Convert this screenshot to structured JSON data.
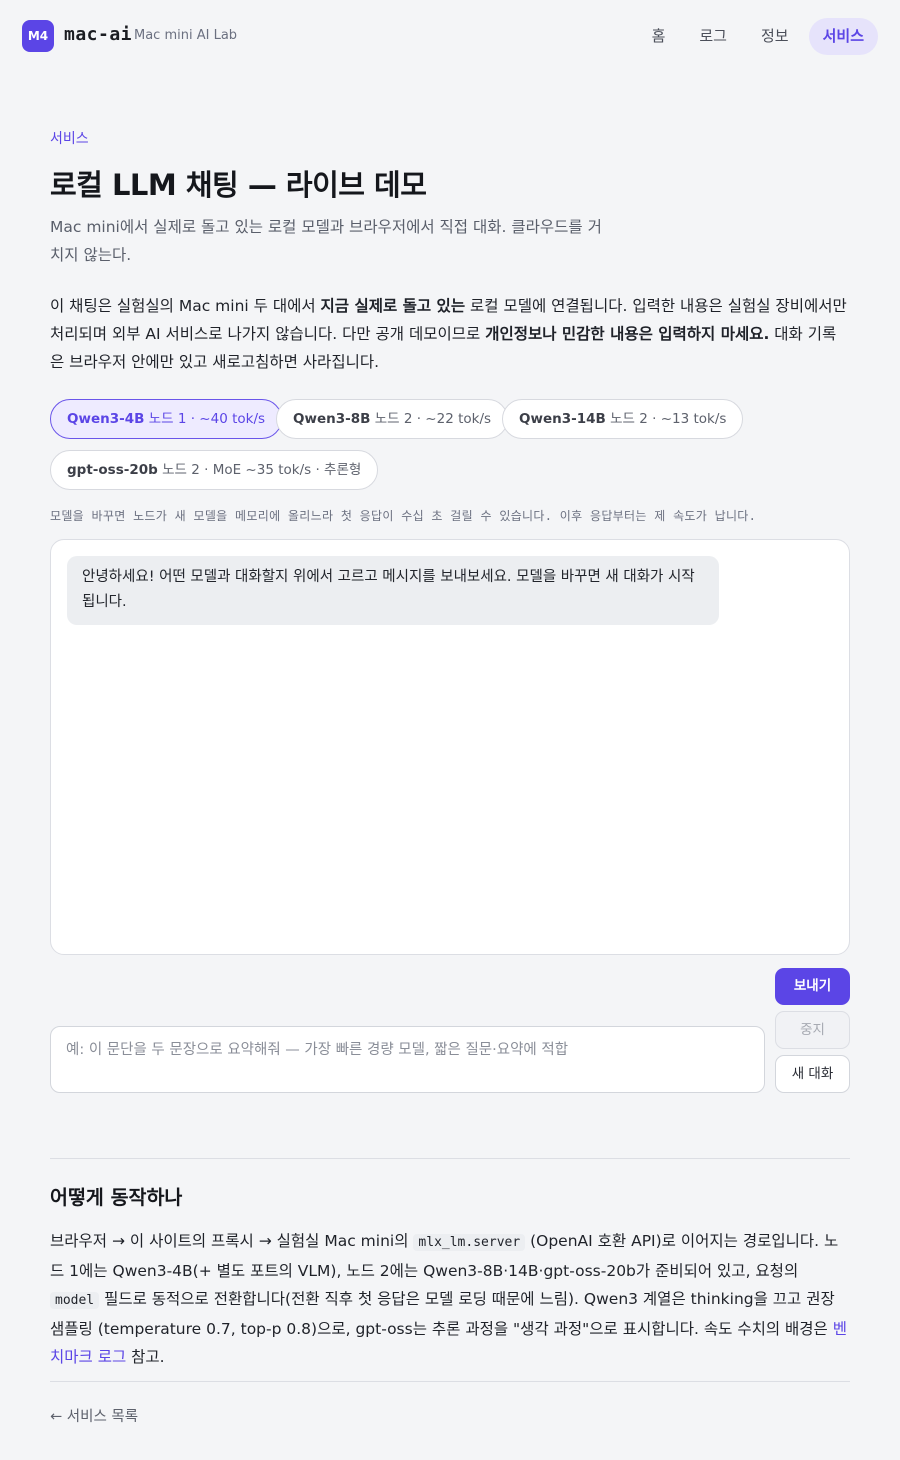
{
  "header": {
    "logo_badge": "M4",
    "site_name": "mac-ai",
    "site_subtitle": "Mac mini AI Lab",
    "nav": [
      {
        "label": "홈",
        "active": false
      },
      {
        "label": "로그",
        "active": false
      },
      {
        "label": "정보",
        "active": false
      },
      {
        "label": "서비스",
        "active": true
      }
    ]
  },
  "page": {
    "breadcrumb": "서비스",
    "title": "로컬 LLM 채팅 — 라이브 데모",
    "lead": "Mac mini에서 실제로 돌고 있는 로컬 모델과 브라우저에서 직접 대화. 클라우드를 거치지 않는다.",
    "intro": {
      "p1": "이 채팅은 실험실의 Mac mini 두 대에서 ",
      "b1": "지금 실제로 돌고 있는",
      "p2": " 로컬 모델에 연결됩니다. 입력한 내용은 실험실 장비에서만 처리되며 외부 AI 서비스로 나가지 않습니다. 다만 공개 데모이므로 ",
      "b2": "개인정보나 민감한 내용은 입력하지 마세요.",
      "p3": " 대화 기록은 브라우저 안에만 있고 새로고침하면 사라집니다."
    }
  },
  "models": [
    {
      "name": "Qwen3-4B",
      "detail": "노드 1 · ~40 tok/s",
      "active": true
    },
    {
      "name": "Qwen3-8B",
      "detail": "노드 2 · ~22 tok/s",
      "active": false
    },
    {
      "name": "Qwen3-14B",
      "detail": "노드 2 · ~13 tok/s",
      "active": false
    },
    {
      "name": "gpt-oss-20b",
      "detail": "노드 2 · MoE ~35 tok/s · 추론형",
      "active": false
    }
  ],
  "model_hint": "모델을 바꾸면 노드가 새 모델을 메모리에 올리느라 첫 응답이 수십 초 걸릴 수 있습니다. 이후 응답부터는 제 속도가 납니다.",
  "chat": {
    "welcome_message": "안녕하세요! 어떤 모델과 대화할지 위에서 고르고 메시지를 보내보세요. 모델을 바꾸면 새 대화가 시작됩니다.",
    "input_placeholder": "예: 이 문단을 두 문장으로 요약해줘 — 가장 빠른 경량 모델, 짧은 질문·요약에 적합",
    "input_value": "",
    "send_label": "보내기",
    "stop_label": "중지",
    "new_chat_label": "새 대화"
  },
  "how": {
    "title": "어떻게 동작하나",
    "t1": "브라우저 → 이 사이트의 프록시 → 실험실 Mac mini의 ",
    "code1": "mlx_lm.server",
    "t2": " (OpenAI 호환 API)로 이어지는 경로입니다. 노드 1에는 Qwen3-4B(+ 별도 포트의 VLM), 노드 2에는 Qwen3-8B·14B·gpt-oss-20b가 준비되어 있고, 요청의 ",
    "code2": "model",
    "t3": " 필드로 동적으로 전환합니다(전환 직후 첫 응답은 모델 로딩 때문에 느림). Qwen3 계열은 thinking을 끄고 권장 샘플링 (temperature 0.7, top-p 0.8)으로, gpt-oss는 추론 과정을 \"생각 과정\"으로 표시합니다. 속도 수치의 배경은 ",
    "link": "벤치마크 로그",
    "t4": " 참고."
  },
  "footer": {
    "back_link": "← 서비스 목록"
  },
  "colors": {
    "accent": "#5b45e6",
    "accent_soft": "#eeebff",
    "background": "#f4f5f7",
    "bubble": "#eceef1"
  }
}
